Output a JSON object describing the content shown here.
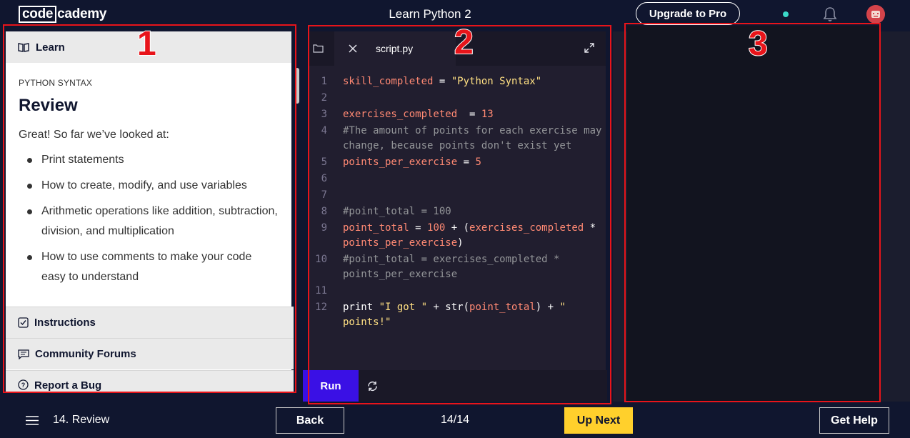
{
  "topbar": {
    "logo_boxed": "code",
    "logo_rest": "cademy",
    "course_title": "Learn Python 2",
    "upgrade_label": "Upgrade to Pro",
    "status_color": "#3bd9c8",
    "icons": [
      "notification-dot",
      "bell-icon",
      "avatar"
    ]
  },
  "learn_panel": {
    "header": "Learn",
    "eyebrow": "PYTHON SYNTAX",
    "title": "Review",
    "lead": "Great! So far we’ve looked at:",
    "bullets": [
      "Print statements",
      "How to create, modify, and use variables",
      "Arithmetic operations like addition, subtraction, division, and multiplication",
      "How to use comments to make your code easy to understand"
    ],
    "sections": [
      {
        "label": "Instructions",
        "icon": "checkbox-icon"
      },
      {
        "label": "Community Forums",
        "icon": "chat-icon"
      },
      {
        "label": "Report a Bug",
        "icon": "help-icon"
      }
    ]
  },
  "editor": {
    "tab_name": "script.py",
    "run_label": "Run",
    "lines": [
      {
        "n": "1",
        "code": "skill_completed = \"Python Syntax\""
      },
      {
        "n": "2",
        "code": ""
      },
      {
        "n": "3",
        "code": "exercises_completed  = 13"
      },
      {
        "n": "4",
        "code": "#The amount of points for each exercise may change, because points don't exist yet"
      },
      {
        "n": "5",
        "code": "points_per_exercise = 5"
      },
      {
        "n": "6",
        "code": ""
      },
      {
        "n": "7",
        "code": ""
      },
      {
        "n": "8",
        "code": "#point_total = 100"
      },
      {
        "n": "9",
        "code": "point_total = 100 + (exercises_completed * points_per_exercise)"
      },
      {
        "n": "10",
        "code": "#point_total = exercises_completed * points_per_exercise"
      },
      {
        "n": "11",
        "code": ""
      },
      {
        "n": "12",
        "code": "print \"I got \" + str(point_total) + \" points!\""
      }
    ],
    "colors": {
      "variable": "#ff8973",
      "string": "#ffe083",
      "number": "#ff8973",
      "comment": "#939598"
    }
  },
  "bottombar": {
    "crumb": "14. Review",
    "back_label": "Back",
    "progress": "14/14",
    "next_label": "Up Next",
    "help_label": "Get Help",
    "next_color": "#ffd02c"
  },
  "annotations": {
    "labels": [
      "1",
      "2",
      "3"
    ],
    "color": "#e8141a"
  }
}
